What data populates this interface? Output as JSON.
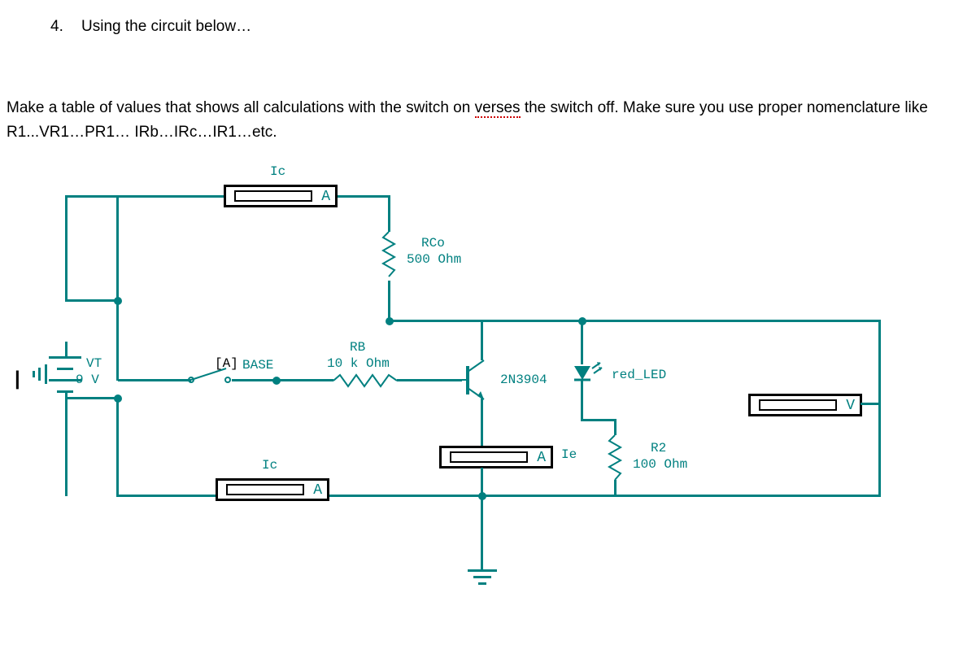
{
  "question": {
    "number": "4.",
    "title": "Using the circuit below…",
    "instruction_part1": "Make a table of values that shows all calculations with the switch on ",
    "instruction_underlined": "verses",
    "instruction_part2": " the switch off. Make sure you use proper nomenclature like R1...VR1…PR1… IRb…IRc…IR1…etc."
  },
  "circuit": {
    "source": {
      "name": "VT",
      "value": "9 V"
    },
    "switch": {
      "label": "[A]",
      "name": "BASE"
    },
    "ammeter_top": {
      "label": "Ic",
      "unit": "A"
    },
    "ammeter_bottom": {
      "label": "Ic",
      "unit": "A"
    },
    "ammeter_emitter": {
      "unit": "A",
      "label": "Ie"
    },
    "voltmeter": {
      "unit": "V"
    },
    "rco": {
      "name": "RCo",
      "value": "500 Ohm"
    },
    "rb": {
      "name": "RB",
      "value": "10 k Ohm"
    },
    "r2": {
      "name": "R2",
      "value": "100 Ohm"
    },
    "transistor": "2N3904",
    "led": "red_LED"
  }
}
